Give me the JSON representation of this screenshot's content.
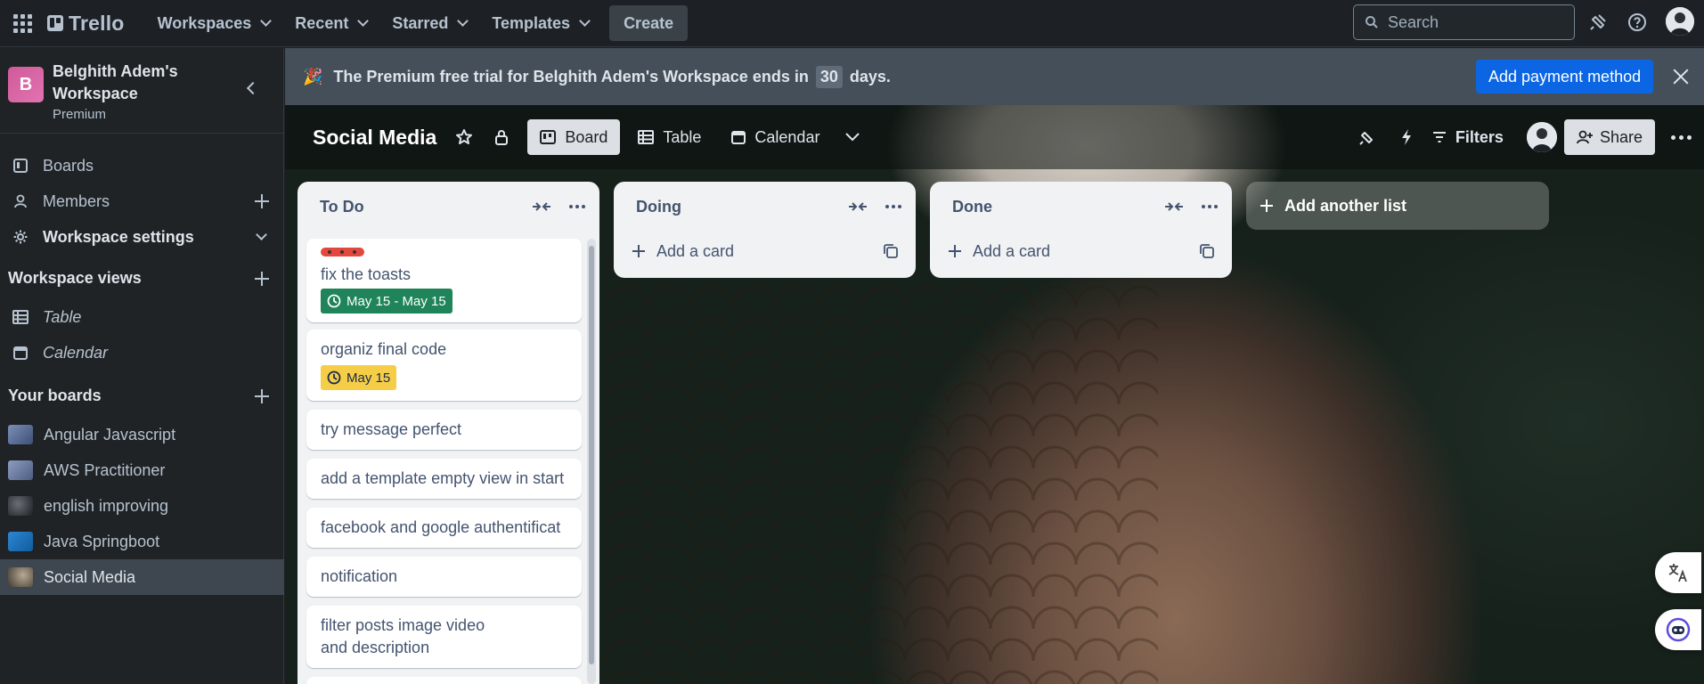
{
  "topnav": {
    "logo_text": "Trello",
    "menu": [
      {
        "label": "Workspaces"
      },
      {
        "label": "Recent"
      },
      {
        "label": "Starred"
      },
      {
        "label": "Templates"
      }
    ],
    "create_label": "Create",
    "search_placeholder": "Search"
  },
  "sidebar": {
    "workspace_initial": "B",
    "workspace_name": "Belghith Adem's Workspace",
    "workspace_plan": "Premium",
    "nav": [
      {
        "label": "Boards"
      },
      {
        "label": "Members"
      },
      {
        "label": "Workspace settings"
      }
    ],
    "views_heading": "Workspace views",
    "views": [
      {
        "label": "Table"
      },
      {
        "label": "Calendar"
      }
    ],
    "boards_heading": "Your boards",
    "boards": [
      {
        "label": "Angular Javascript",
        "color": "#4a5f8a"
      },
      {
        "label": "AWS Practitioner",
        "color": "#5a6d8f"
      },
      {
        "label": "english improving",
        "color": "#2a2d30"
      },
      {
        "label": "Java Springboot",
        "color": "#1d6fb8"
      },
      {
        "label": "Social Media",
        "color": "#6b6458",
        "active": true
      }
    ]
  },
  "banner": {
    "text_before": "The Premium free trial for Belghith Adem's Workspace ends in",
    "days": "30",
    "text_after": "days.",
    "button_label": "Add payment method"
  },
  "board": {
    "title": "Social Media",
    "views": [
      {
        "label": "Board",
        "active": true
      },
      {
        "label": "Table"
      },
      {
        "label": "Calendar"
      }
    ],
    "filters_label": "Filters",
    "share_label": "Share"
  },
  "lists": [
    {
      "title": "To Do",
      "cards": [
        {
          "title": "fix the toasts",
          "label_color": "#e2483d",
          "due": "May 15 - May 15",
          "due_status": "complete"
        },
        {
          "title": "organiz final code",
          "due": "May 15",
          "due_status": "due-soon"
        },
        {
          "title": "try message perfect"
        },
        {
          "title": "add a template empty view in start"
        },
        {
          "title": "facebook and google authentificat"
        },
        {
          "title": "notification"
        },
        {
          "title": "filter posts image video and description"
        }
      ]
    },
    {
      "title": "Doing",
      "add_card_label": "Add a card"
    },
    {
      "title": "Done",
      "add_card_label": "Add a card"
    }
  ],
  "add_list_label": "Add another list",
  "colors": {
    "accent": "#0c66e4",
    "due_green": "#1f845a",
    "due_yellow": "#f5cd47",
    "label_red": "#e2483d"
  }
}
